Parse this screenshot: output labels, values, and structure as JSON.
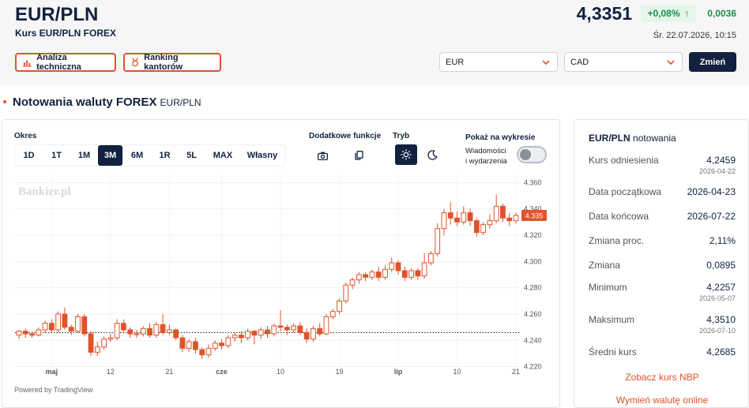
{
  "header": {
    "pair": "EUR/PLN",
    "subtitle": "Kurs EUR/PLN FOREX",
    "price": "4,3351",
    "change_pct": "+0,08%",
    "change_arrow": "↑",
    "change_abs": "0,0036",
    "timestamp": "Śr. 22.07.2026, 10:15",
    "colors": {
      "accent": "#e0532b",
      "navy": "#12213f",
      "positive": "#1d8f4a"
    }
  },
  "actions": {
    "technical": {
      "label": "Analiza techniczna",
      "icon": "bar-chart-icon"
    },
    "ranking": {
      "label": "Ranking kantorów",
      "icon": "ranking-icon"
    }
  },
  "converter": {
    "from": "EUR",
    "to": "CAD",
    "submit": "Zmień"
  },
  "section": {
    "title": "Notowania waluty FOREX",
    "subtitle": "EUR/PLN"
  },
  "chart_controls": {
    "period_label": "Okres",
    "periods": [
      "1D",
      "1T",
      "1M",
      "3M",
      "6M",
      "1R",
      "5L",
      "MAX",
      "Własny"
    ],
    "active_period": "3M",
    "extra_label": "Dodatkowe funkcje",
    "mode_label": "Tryb",
    "news_title": "Pokaż na wykresie",
    "news_line1": "Wiadomości",
    "news_line2": "i wydarzenia",
    "news_enabled": false,
    "watermark": "Bankier.pl",
    "powered": "Powered by TradingView"
  },
  "chart_data": {
    "type": "candlestick",
    "y_ticks": [
      "4.360",
      "4.340",
      "4.320",
      "4.300",
      "4.280",
      "4.260",
      "4.240",
      "4.220"
    ],
    "ylim": [
      4.218,
      4.362
    ],
    "x_ticks": [
      "maj",
      "12",
      "21",
      "cze",
      "10",
      "19",
      "lip",
      "10",
      "21"
    ],
    "reference_line": 4.2459,
    "last_price_label": "4.335",
    "last_price": 4.335,
    "candles": [
      [
        4.244,
        4.247,
        4.241,
        4.248
      ],
      [
        4.247,
        4.245,
        4.242,
        4.249
      ],
      [
        4.245,
        4.244,
        4.242,
        4.247
      ],
      [
        4.244,
        4.248,
        4.243,
        4.25
      ],
      [
        4.248,
        4.253,
        4.246,
        4.255
      ],
      [
        4.253,
        4.248,
        4.246,
        4.256
      ],
      [
        4.248,
        4.26,
        4.246,
        4.262
      ],
      [
        4.26,
        4.25,
        4.248,
        4.265
      ],
      [
        4.25,
        4.247,
        4.244,
        4.252
      ],
      [
        4.247,
        4.258,
        4.246,
        4.26
      ],
      [
        4.258,
        4.245,
        4.243,
        4.26
      ],
      [
        4.245,
        4.231,
        4.228,
        4.247
      ],
      [
        4.231,
        4.235,
        4.228,
        4.239
      ],
      [
        4.235,
        4.241,
        4.233,
        4.243
      ],
      [
        4.241,
        4.242,
        4.239,
        4.245
      ],
      [
        4.242,
        4.253,
        4.24,
        4.256
      ],
      [
        4.253,
        4.248,
        4.245,
        4.256
      ],
      [
        4.248,
        4.245,
        4.242,
        4.25
      ],
      [
        4.245,
        4.245,
        4.242,
        4.248
      ],
      [
        4.245,
        4.249,
        4.243,
        4.251
      ],
      [
        4.249,
        4.244,
        4.242,
        4.253
      ],
      [
        4.244,
        4.252,
        4.242,
        4.254
      ],
      [
        4.252,
        4.246,
        4.244,
        4.26
      ],
      [
        4.246,
        4.248,
        4.244,
        4.252
      ],
      [
        4.248,
        4.242,
        4.24,
        4.249
      ],
      [
        4.242,
        4.234,
        4.231,
        4.244
      ],
      [
        4.234,
        4.239,
        4.231,
        4.241
      ],
      [
        4.239,
        4.233,
        4.23,
        4.242
      ],
      [
        4.233,
        4.229,
        4.226,
        4.235
      ],
      [
        4.229,
        4.234,
        4.227,
        4.237
      ],
      [
        4.234,
        4.238,
        4.232,
        4.24
      ],
      [
        4.238,
        4.236,
        4.233,
        4.241
      ],
      [
        4.236,
        4.242,
        4.234,
        4.244
      ],
      [
        4.242,
        4.244,
        4.239,
        4.246
      ],
      [
        4.244,
        4.242,
        4.238,
        4.247
      ],
      [
        4.242,
        4.247,
        4.24,
        4.249
      ],
      [
        4.247,
        4.244,
        4.237,
        4.248
      ],
      [
        4.244,
        4.248,
        4.241,
        4.25
      ],
      [
        4.248,
        4.245,
        4.242,
        4.251
      ],
      [
        4.245,
        4.251,
        4.243,
        4.253
      ],
      [
        4.251,
        4.25,
        4.247,
        4.263
      ],
      [
        4.25,
        4.248,
        4.244,
        4.252
      ],
      [
        4.248,
        4.251,
        4.246,
        4.253
      ],
      [
        4.251,
        4.246,
        4.244,
        4.254
      ],
      [
        4.246,
        4.241,
        4.238,
        4.249
      ],
      [
        4.241,
        4.249,
        4.239,
        4.251
      ],
      [
        4.249,
        4.245,
        4.243,
        4.253
      ],
      [
        4.245,
        4.258,
        4.244,
        4.26
      ],
      [
        4.258,
        4.262,
        4.256,
        4.264
      ],
      [
        4.262,
        4.27,
        4.26,
        4.272
      ],
      [
        4.27,
        4.282,
        4.268,
        4.284
      ],
      [
        4.282,
        4.286,
        4.279,
        4.288
      ],
      [
        4.286,
        4.29,
        4.283,
        4.292
      ],
      [
        4.29,
        4.288,
        4.285,
        4.292
      ],
      [
        4.288,
        4.292,
        4.286,
        4.294
      ],
      [
        4.292,
        4.288,
        4.285,
        4.296
      ],
      [
        4.288,
        4.294,
        4.286,
        4.297
      ],
      [
        4.294,
        4.299,
        4.292,
        4.303
      ],
      [
        4.299,
        4.293,
        4.29,
        4.301
      ],
      [
        4.293,
        4.288,
        4.285,
        4.296
      ],
      [
        4.288,
        4.293,
        4.286,
        4.295
      ],
      [
        4.293,
        4.289,
        4.286,
        4.295
      ],
      [
        4.289,
        4.299,
        4.287,
        4.306
      ],
      [
        4.299,
        4.306,
        4.297,
        4.308
      ],
      [
        4.306,
        4.325,
        4.304,
        4.329
      ],
      [
        4.325,
        4.337,
        4.32,
        4.34
      ],
      [
        4.337,
        4.333,
        4.328,
        4.345
      ],
      [
        4.333,
        4.33,
        4.327,
        4.338
      ],
      [
        4.33,
        4.337,
        4.328,
        4.342
      ],
      [
        4.337,
        4.331,
        4.327,
        4.34
      ],
      [
        4.331,
        4.322,
        4.319,
        4.333
      ],
      [
        4.322,
        4.328,
        4.32,
        4.33
      ],
      [
        4.328,
        4.331,
        4.325,
        4.336
      ],
      [
        4.331,
        4.342,
        4.329,
        4.351
      ],
      [
        4.342,
        4.333,
        4.33,
        4.344
      ],
      [
        4.333,
        4.331,
        4.327,
        4.337
      ],
      [
        4.331,
        4.335,
        4.329,
        4.337
      ]
    ]
  },
  "sidebar": {
    "title_pair": "EUR/PLN",
    "title_rest": "notowania",
    "rows": [
      {
        "label": "Kurs odniesienia",
        "value": "4,2459",
        "date": "2026-04-22"
      },
      {
        "label": "Data początkowa",
        "value": "2026-04-23",
        "date": ""
      },
      {
        "label": "Data końcowa",
        "value": "2026-07-22",
        "date": ""
      },
      {
        "label": "Zmiana proc.",
        "value": "2,11%",
        "date": ""
      },
      {
        "label": "Zmiana",
        "value": "0,0895",
        "date": ""
      },
      {
        "label": "Minimum",
        "value": "4,2257",
        "date": "2026-05-07"
      },
      {
        "label": "Maksimum",
        "value": "4,3510",
        "date": "2026-07-10"
      },
      {
        "label": "Średni kurs",
        "value": "4,2685",
        "date": ""
      }
    ],
    "link_nbp": "Zobacz kurs NBP",
    "link_exchange": "Wymień walutę online"
  }
}
